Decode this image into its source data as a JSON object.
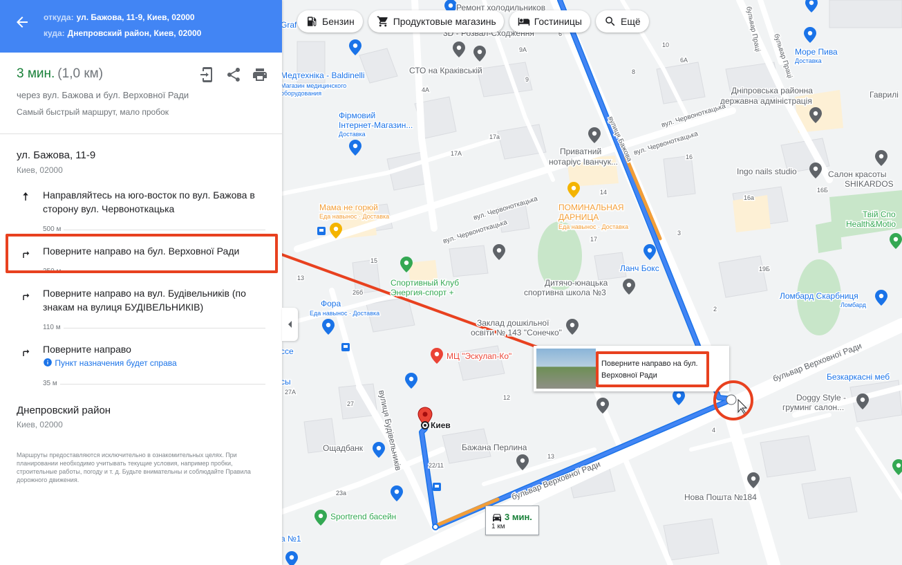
{
  "header": {
    "from_label": "откуда:",
    "from_value": "ул. Бажова, 11-9, Киев, 02000",
    "to_label": "куда:",
    "to_value": "Днепровский район, Киев, 02000"
  },
  "summary": {
    "time": "3 мин.",
    "distance": "(1,0 км)",
    "via": "через вул. Бажова и бул. Верховної Ради",
    "note": "Самый быстрый маршрут, мало пробок"
  },
  "start": {
    "title": "ул. Бажова, 11-9",
    "subtitle": "Киев, 02000"
  },
  "steps": [
    {
      "text": "Направляйтесь на юго-восток по вул. Бажова в сторону вул. Червоноткацька",
      "distance": "500 м",
      "icon": "arrow-up-icon"
    },
    {
      "text": "Поверните направо на бул. Верховної Ради",
      "distance": "250 м",
      "icon": "turn-right-icon"
    },
    {
      "text": "Поверните направо на вул. Будівельників (по знакам на вулиця БУДІВЕЛЬНИКІВ)",
      "distance": "110 м",
      "icon": "turn-right-icon"
    },
    {
      "text": "Поверните направо",
      "distance": "35 м",
      "icon": "turn-right-icon",
      "info": "Пункт назначения будет справа"
    }
  ],
  "end": {
    "title": "Днепровский район",
    "subtitle": "Киев, 02000"
  },
  "disclaimer": "Маршруты предоставляются исключительно в ознакомительных целях. При планировании необходимо учитывать текущие условия, например пробки, строительные работы, погоду и т. д. Будьте внимательны и соблюдайте Правила дорожного движения.",
  "chips": [
    "Бензин",
    "Продуктовые магазины",
    "Гостиницы",
    "Ещё"
  ],
  "streetview_tip": "Поверните направо на бул. Верховної Ради",
  "route_badge": {
    "time": "3 мин.",
    "distance": "1 км"
  },
  "map": {
    "labels": [
      {
        "text": "Ремонт холодильников"
      },
      {
        "text": "3D - Розвал-Сходження"
      },
      {
        "text": "СТО на Краківській"
      },
      {
        "text": "Медтехніка - Baldinelli"
      },
      {
        "text": "Магазин медицинского"
      },
      {
        "text": "оборудования"
      },
      {
        "text": "Фірмовий"
      },
      {
        "text": "Інтернет-Магазин..."
      },
      {
        "text": "Доставка"
      },
      {
        "text": "Приватний"
      },
      {
        "text": "нотаріус Іванчук..."
      },
      {
        "text": "Мама не горюй"
      },
      {
        "text": "Еда навынос · Доставка"
      },
      {
        "text": "ПОМИНАЛЬНАЯ"
      },
      {
        "text": "ДАРНИЦА"
      },
      {
        "text": "Еда навынос · Доставка"
      },
      {
        "text": "Ланч Бокс"
      },
      {
        "text": "Спортивный Клуб"
      },
      {
        "text": "Энергия-спорт +"
      },
      {
        "text": "Дитячо-юнацька"
      },
      {
        "text": "спортивна школа №3"
      },
      {
        "text": "Фора"
      },
      {
        "text": "Еда навынос · Доставка"
      },
      {
        "text": "Заклад дошкільної"
      },
      {
        "text": "освіти № 143 \"Сонечко\""
      },
      {
        "text": "МЦ \"Эскулап-Ко\""
      },
      {
        "text": "Киев"
      },
      {
        "text": "Ощадбанк"
      },
      {
        "text": "Бажана Перлина"
      },
      {
        "text": "Sportrend басейн"
      },
      {
        "text": "Нова Пошта №184"
      },
      {
        "text": "Doggy Style -"
      },
      {
        "text": "груминг салон..."
      },
      {
        "text": "Безкаркасні меб"
      },
      {
        "text": "Ломбард Скарбниця"
      },
      {
        "text": "Ломбард"
      },
      {
        "text": "Дніпровська районна"
      },
      {
        "text": "державна адміністрація"
      },
      {
        "text": "Ingo nails studio"
      },
      {
        "text": "Салон красоты"
      },
      {
        "text": "SHIKARDOS"
      },
      {
        "text": "Твій Спо"
      },
      {
        "text": "Health&Motio"
      },
      {
        "text": "Море Пива"
      },
      {
        "text": "Доставка"
      },
      {
        "text": "Гаврилі"
      },
      {
        "text": "бульвар Верховної Ради"
      },
      {
        "text": "вулиця Будівельників"
      },
      {
        "text": "вулиця Бажова"
      },
      {
        "text": "вул. Червоноткацька"
      },
      {
        "text": "вул. Червоноткацька"
      },
      {
        "text": "вул. Червоноткацька"
      },
      {
        "text": "вул. Червоноткацька"
      },
      {
        "text": "бульвар Верховної Ради"
      },
      {
        "text": "бульвар Праці"
      },
      {
        "text": "бульвар Праці"
      },
      {
        "text": "Graf"
      },
      {
        "text": "сce"
      },
      {
        "text": "сы"
      },
      {
        "text": "а №1"
      },
      {
        "text": "13"
      },
      {
        "text": "15"
      },
      {
        "text": "17а"
      },
      {
        "text": "17А"
      },
      {
        "text": "9"
      },
      {
        "text": "4А"
      },
      {
        "text": "9А"
      },
      {
        "text": "6А"
      },
      {
        "text": "14"
      },
      {
        "text": "16"
      },
      {
        "text": "16а"
      },
      {
        "text": "16Б"
      },
      {
        "text": "19Б"
      },
      {
        "text": "27А"
      },
      {
        "text": "27"
      },
      {
        "text": "26б"
      },
      {
        "text": "22/11"
      },
      {
        "text": "23а"
      },
      {
        "text": "13"
      },
      {
        "text": "2"
      },
      {
        "text": "4"
      },
      {
        "text": "6"
      },
      {
        "text": "8"
      },
      {
        "text": "10"
      },
      {
        "text": "12"
      },
      {
        "text": "17"
      },
      {
        "text": "3"
      }
    ]
  }
}
